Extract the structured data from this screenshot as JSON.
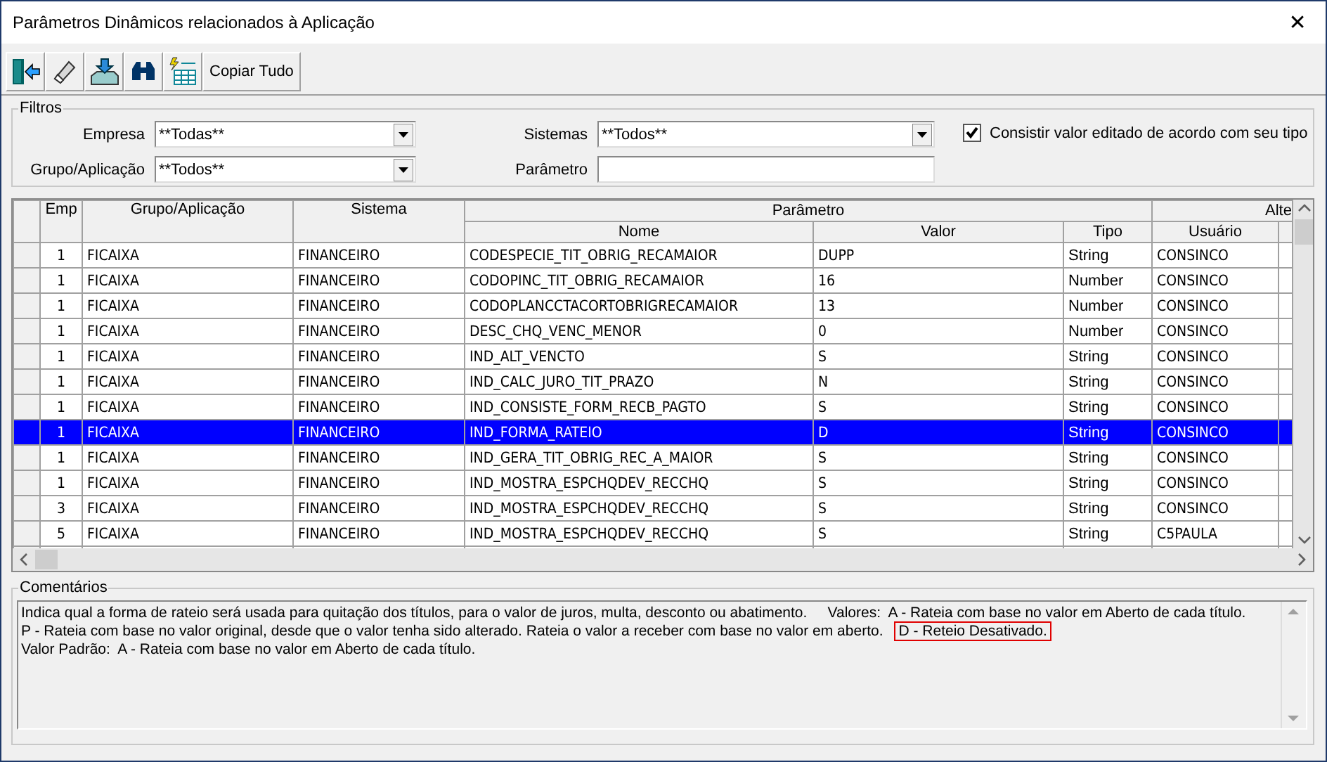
{
  "window": {
    "title": "Parâmetros Dinâmicos relacionados à Aplicação",
    "close": "✕"
  },
  "toolbar": [
    {
      "kind": "exit"
    },
    {
      "kind": "eraser"
    },
    {
      "kind": "import"
    },
    {
      "kind": "binoculars"
    },
    {
      "kind": "grid"
    },
    {
      "kind": "text",
      "label": "Copiar Tudo"
    }
  ],
  "filters": {
    "title": "Filtros",
    "fields": [
      {
        "label": "Empresa",
        "kind": "combo",
        "value": "**Todas**"
      },
      {
        "label": "Sistemas",
        "kind": "combo",
        "value": "**Todos**"
      },
      {
        "label": "Grupo/Aplicação",
        "kind": "combo",
        "value": "**Todos**"
      },
      {
        "label": "Parâmetro",
        "kind": "text"
      }
    ],
    "checkbox": {
      "label": "Consistir valor editado de acordo com seu tipo",
      "checked": true
    }
  },
  "grid": {
    "group_headers": [
      "Parâmetro",
      "Alte"
    ],
    "columns": [
      "Emp",
      "Grupo/Aplicação",
      "Sistema",
      "Nome",
      "Valor",
      "Tipo",
      "Usuário"
    ],
    "rows": [
      {
        "selected": false,
        "cells": [
          "1",
          "FICAIXA",
          "FINANCEIRO",
          "CODESPECIE_TIT_OBRIG_RECAMAIOR",
          "DUPP",
          "String",
          "CONSINCO"
        ]
      },
      {
        "selected": false,
        "cells": [
          "1",
          "FICAIXA",
          "FINANCEIRO",
          "CODOPINC_TIT_OBRIG_RECAMAIOR",
          "16",
          "Number",
          "CONSINCO"
        ]
      },
      {
        "selected": false,
        "cells": [
          "1",
          "FICAIXA",
          "FINANCEIRO",
          "CODOPLANCCTACORTOBRIGRECAMAIOR",
          "13",
          "Number",
          "CONSINCO"
        ]
      },
      {
        "selected": false,
        "cells": [
          "1",
          "FICAIXA",
          "FINANCEIRO",
          "DESC_CHQ_VENC_MENOR",
          "0",
          "Number",
          "CONSINCO"
        ]
      },
      {
        "selected": false,
        "cells": [
          "1",
          "FICAIXA",
          "FINANCEIRO",
          "IND_ALT_VENCTO",
          "S",
          "String",
          "CONSINCO"
        ]
      },
      {
        "selected": false,
        "cells": [
          "1",
          "FICAIXA",
          "FINANCEIRO",
          "IND_CALC_JURO_TIT_PRAZO",
          "N",
          "String",
          "CONSINCO"
        ]
      },
      {
        "selected": false,
        "cells": [
          "1",
          "FICAIXA",
          "FINANCEIRO",
          "IND_CONSISTE_FORM_RECB_PAGTO",
          "S",
          "String",
          "CONSINCO"
        ]
      },
      {
        "selected": true,
        "cells": [
          "1",
          "FICAIXA",
          "FINANCEIRO",
          "IND_FORMA_RATEIO",
          "D",
          "String",
          "CONSINCO"
        ]
      },
      {
        "selected": false,
        "cells": [
          "1",
          "FICAIXA",
          "FINANCEIRO",
          "IND_GERA_TIT_OBRIG_REC_A_MAIOR",
          "S",
          "String",
          "CONSINCO"
        ]
      },
      {
        "selected": false,
        "cells": [
          "1",
          "FICAIXA",
          "FINANCEIRO",
          "IND_MOSTRA_ESPCHQDEV_RECCHQ",
          "S",
          "String",
          "CONSINCO"
        ]
      },
      {
        "selected": false,
        "cells": [
          "3",
          "FICAIXA",
          "FINANCEIRO",
          "IND_MOSTRA_ESPCHQDEV_RECCHQ",
          "S",
          "String",
          "CONSINCO"
        ]
      },
      {
        "selected": false,
        "cells": [
          "5",
          "FICAIXA",
          "FINANCEIRO",
          "IND_MOSTRA_ESPCHQDEV_RECCHQ",
          "S",
          "String",
          "C5PAULA"
        ]
      }
    ]
  },
  "comments": {
    "title": "Comentários",
    "lines": [
      [
        {
          "text": "Indica qual a forma de rateio será usada para quitação dos títulos, para o valor de juros, multa, desconto ou abatimento.     Valores:  A - Rateia com base no valor em Aberto de cada título.",
          "boxed": false
        }
      ],
      [
        {
          "text": "P - Rateia com base no valor original, desde que o valor tenha sido alterado. Rateia o valor a receber com base no valor em aberto.",
          "boxed": false
        },
        {
          "text": "D - Reteio Desativado.",
          "boxed": true
        }
      ],
      [
        {
          "text": "Valor Padrão:  A - Rateia com base no valor em Aberto de cada título.",
          "boxed": false
        }
      ]
    ]
  }
}
